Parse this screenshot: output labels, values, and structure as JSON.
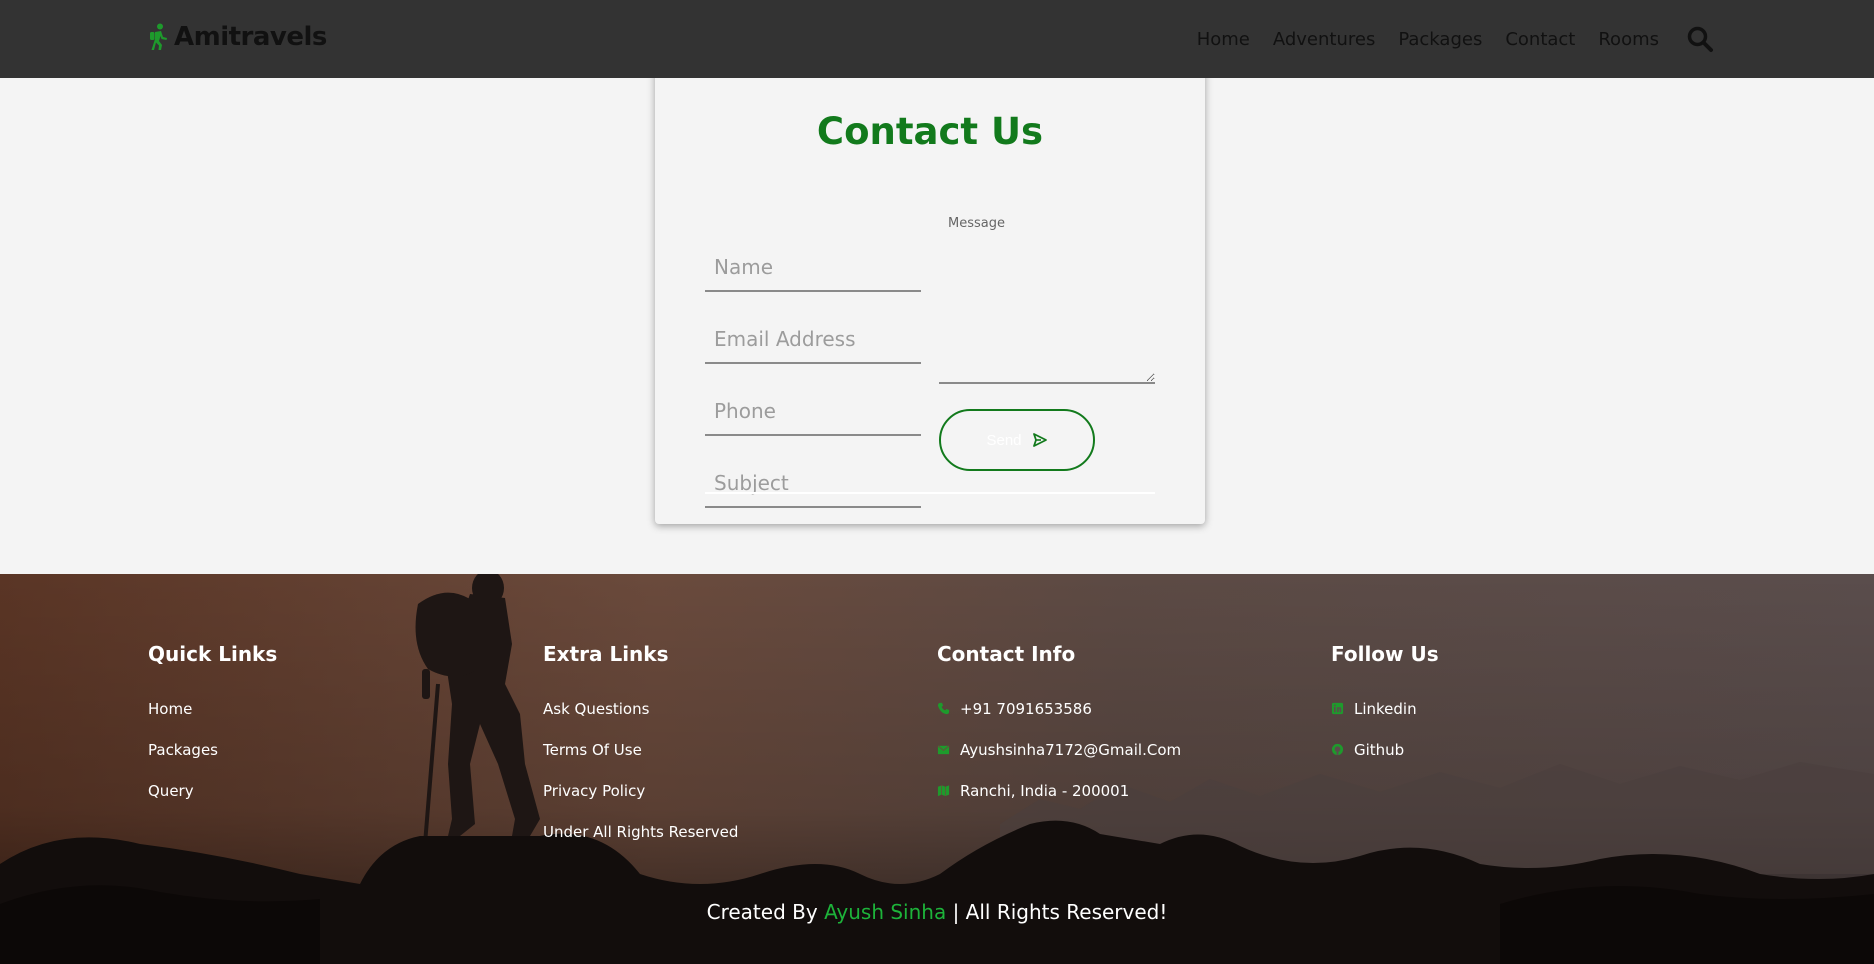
{
  "header": {
    "brand": "Amitravels",
    "nav": [
      "Home",
      "Adventures",
      "Packages",
      "Contact",
      "Rooms"
    ]
  },
  "contact": {
    "title": "Contact Us",
    "name_placeholder": "Name",
    "email_placeholder": "Email Address",
    "phone_placeholder": "Phone",
    "subject_placeholder": "Subject",
    "message_placeholder": "Message",
    "send_label": "Send"
  },
  "footer": {
    "quick_links": {
      "title": "Quick Links",
      "items": [
        "Home",
        "Packages",
        "Query"
      ]
    },
    "extra_links": {
      "title": "Extra Links",
      "items": [
        "Ask Questions",
        "Terms Of Use",
        "Privacy Policy",
        "Under All Rights Reserved"
      ]
    },
    "contact_info": {
      "title": "Contact Info",
      "phone": "+91 7091653586",
      "email": "Ayushsinha7172@Gmail.Com",
      "address": "Ranchi, India - 200001"
    },
    "follow_us": {
      "title": "Follow Us",
      "items": [
        "Linkedin",
        "Github"
      ]
    },
    "credit_prefix": "Created By",
    "credit_author": "Ayush Sinha",
    "credit_suffix": "| All Rights Reserved!"
  },
  "colors": {
    "accent": "#127a1c",
    "header_bg": "#333333",
    "page_bg": "#f4f4f4"
  },
  "icons": [
    "hiker-icon",
    "search-icon",
    "send-icon",
    "phone-icon",
    "envelope-icon",
    "map-icon",
    "linkedin-icon",
    "github-icon"
  ]
}
